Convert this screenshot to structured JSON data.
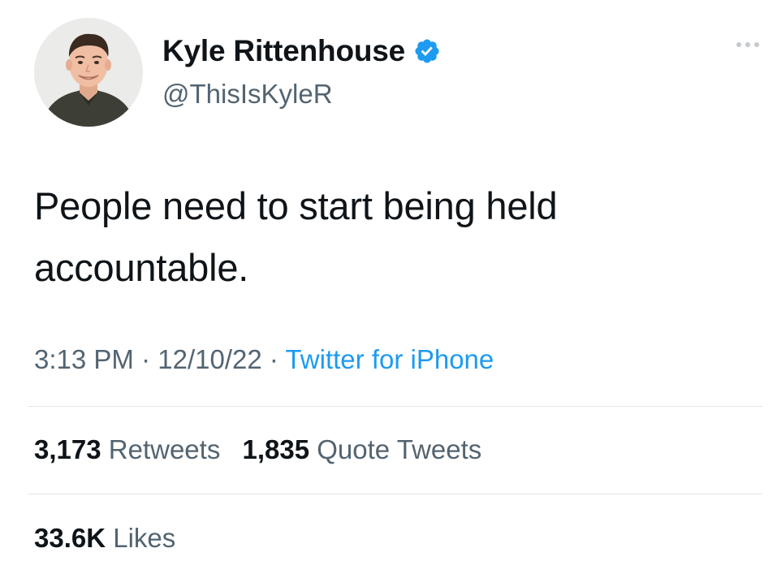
{
  "user": {
    "display_name": "Kyle Rittenhouse",
    "handle": "@ThisIsKyleR",
    "verified": true,
    "avatar_icon": "profile-photo"
  },
  "tweet": {
    "text": "People need to start being held accountable.",
    "time": "3:13 PM",
    "date": "12/10/22",
    "separator": "·",
    "source": "Twitter for iPhone"
  },
  "stats": {
    "retweets_count": "3,173",
    "retweets_label": "Retweets",
    "quotes_count": "1,835",
    "quotes_label": "Quote Tweets",
    "likes_count": "33.6K",
    "likes_label": "Likes"
  },
  "colors": {
    "text": "#0f1419",
    "secondary": "#536471",
    "link": "#1d9bf0",
    "verified": "#1d9bf0",
    "divider": "#e3e6e8"
  }
}
